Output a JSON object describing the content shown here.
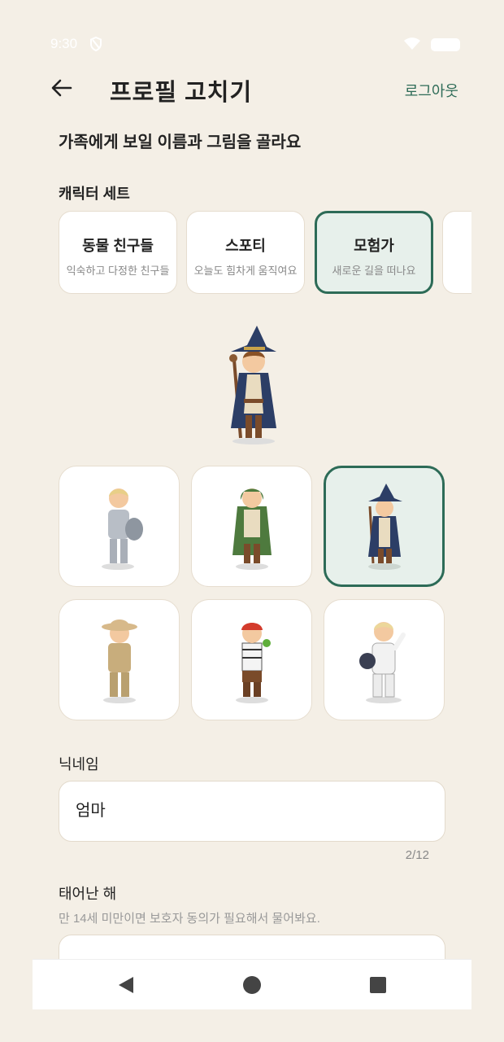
{
  "status_bar": {
    "time": "9:30"
  },
  "header": {
    "title": "프로필 고치기",
    "logout_label": "로그아웃"
  },
  "subtitle": "가족에게 보일 이름과 그림을 골라요",
  "character_set": {
    "label": "캐릭터 세트",
    "sets": [
      {
        "name": "동물 친구들",
        "desc": "익숙하고 다정한 친구들"
      },
      {
        "name": "스포티",
        "desc": "오늘도 힘차게 움직여요"
      },
      {
        "name": "모험가",
        "desc": "새로운 길을 떠나요",
        "selected": true
      }
    ]
  },
  "characters": [
    {
      "name": "knight",
      "selected": false
    },
    {
      "name": "archer",
      "selected": false
    },
    {
      "name": "wizard",
      "selected": true
    },
    {
      "name": "explorer",
      "selected": false
    },
    {
      "name": "pirate",
      "selected": false
    },
    {
      "name": "astronaut",
      "selected": false
    }
  ],
  "nickname": {
    "label": "닉네임",
    "value": "엄마",
    "counter": "2/12"
  },
  "birth_year": {
    "label": "태어난 해",
    "hint": "만 14세 미만이면 보호자 동의가 필요해서 물어봐요."
  },
  "colors": {
    "background": "#f4efe6",
    "accent": "#2d6b57",
    "selected_bg": "#e7f0eb"
  },
  "icons": {
    "back": "arrow-left-icon",
    "nav": [
      "back-triangle-icon",
      "home-circle-icon",
      "recents-square-icon"
    ]
  }
}
